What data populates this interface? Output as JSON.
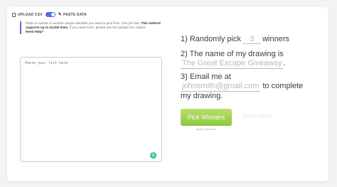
{
  "mode": {
    "upload_label": "UPLOAD CSV",
    "paste_label": "PASTE DATA",
    "active": "paste"
  },
  "info": {
    "line1": "Paste in names or another unique identifier you want to pick from. One per line.",
    "bold": "This method supports up to 20,000 lines.",
    "line2": "If you need more, please use the upload CSV option.",
    "help": "Need Help?"
  },
  "list_input": {
    "placeholder": "Paste your list here",
    "value": ""
  },
  "form": {
    "line1_prefix": "1) Randomly pick",
    "winners_value": "3",
    "line1_suffix": "winners",
    "line2_prefix": "2) The name of my drawing is",
    "drawing_name_placeholder": "The Great Escape Giveaway",
    "line2_suffix": ".",
    "line3_prefix": "3) Email me at",
    "email_placeholder": "johnsmith@gmail.com",
    "line3_suffix": "to complete my drawing."
  },
  "actions": {
    "pick_winners_label": "Pick Winners",
    "under_button_text": "Always 100% free",
    "more_tools_label": "More tools"
  },
  "colors": {
    "accent": "#4a6cf7",
    "button_green": "#8bc83e",
    "grammarly": "#15c39a"
  }
}
